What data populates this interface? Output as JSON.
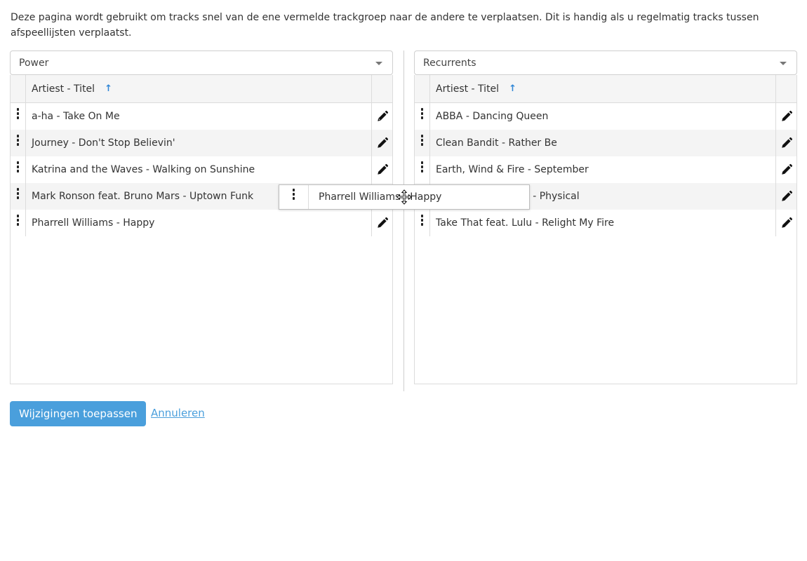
{
  "intro_text": "Deze pagina wordt gebruikt om tracks snel van de ene vermelde trackgroep naar de andere te verplaatsen. Dit is handig als u regelmatig tracks tussen afspeellijsten verplaatst.",
  "left_panel": {
    "selected_group": "Power",
    "column_header": "Artiest - Titel",
    "sort_indicator": "↑",
    "tracks": [
      "a-ha - Take On Me",
      "Journey - Don't Stop Believin'",
      "Katrina and the Waves - Walking on Sunshine",
      "Mark Ronson feat. Bruno Mars - Uptown Funk",
      "Pharrell Williams - Happy"
    ]
  },
  "right_panel": {
    "selected_group": "Recurrents",
    "column_header": "Artiest - Titel",
    "sort_indicator": "↑",
    "tracks": [
      "ABBA - Dancing Queen",
      "Clean Bandit - Rather Be",
      "Earth, Wind & Fire - September",
      "Olivia Newton-John - Physical",
      "Take That feat. Lulu - Relight My Fire"
    ]
  },
  "drag_ghost": {
    "title": "Pharrell Williams - Happy"
  },
  "actions": {
    "apply_label": "Wijzigingen toepassen",
    "cancel_label": "Annuleren"
  },
  "colors": {
    "accent": "#4a9fdc",
    "sort_arrow": "#2f86d6"
  },
  "icons": {
    "drag_handle": "vertical-dots-icon",
    "edit": "pencil-icon",
    "dropdown": "caret-down-icon",
    "cursor": "move-cursor-icon"
  }
}
